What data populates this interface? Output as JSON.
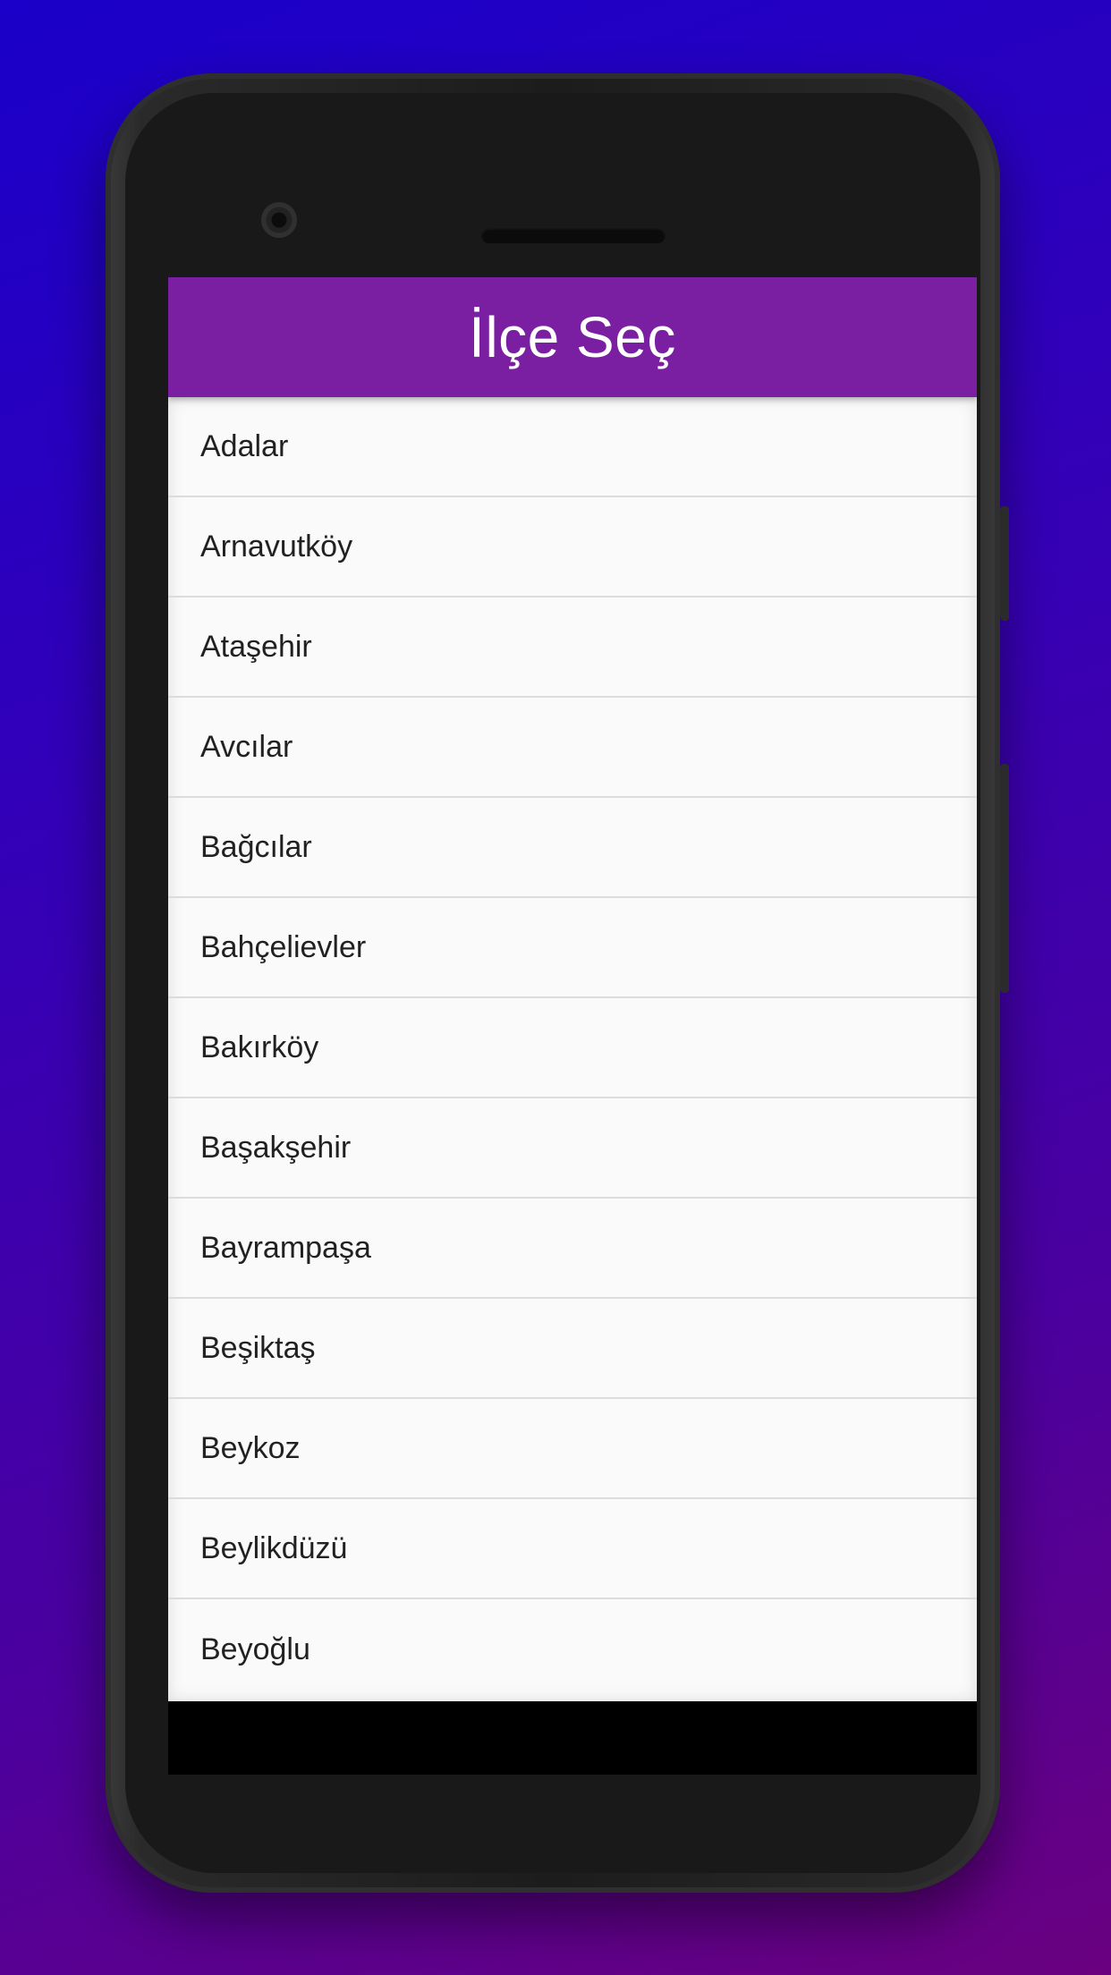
{
  "app_bar": {
    "title": "İlçe Seç",
    "color": "#7b1fa2"
  },
  "districts": [
    "Adalar",
    "Arnavutköy",
    "Ataşehir",
    "Avcılar",
    "Bağcılar",
    "Bahçelievler",
    "Bakırköy",
    "Başakşehir",
    "Bayrampaşa",
    "Beşiktaş",
    "Beykoz",
    "Beylikdüzü",
    "Beyoğlu"
  ]
}
